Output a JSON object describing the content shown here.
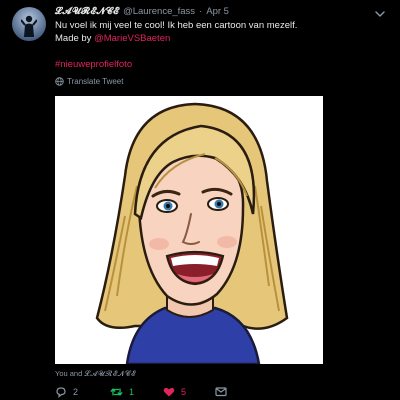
{
  "tweet": {
    "author_name": "𝓛𝓐𝓤𝓡𝓔𝓝𝓒𝓔",
    "handle": "@Laurence_fass",
    "separator": "·",
    "date": "Apr 5",
    "text_line1": "Nu voel ik mij veel te cool! Ik heb een cartoon van mezelf.",
    "text_line2_prefix": "Made by ",
    "text_line2_mention": "@MarieVSBaeten",
    "hashtag": "#nieuweprofielfoto",
    "translate_label": "Translate Tweet"
  },
  "liked_by": {
    "prefix": "You and ",
    "who": "𝓛𝓐𝓤𝓡𝓔𝓝𝓒𝓔"
  },
  "actions": {
    "reply_count": "2",
    "retweet_count": "1",
    "like_count": "5"
  },
  "icons": {
    "reply": "reply-bubble-icon",
    "retweet": "retweet-icon",
    "like": "heart-icon",
    "dm": "envelope-icon",
    "globe": "globe-icon",
    "more": "chevron-down-icon"
  },
  "colors": {
    "background": "#000000",
    "text": "#e7e9ea",
    "secondary": "#8b98a5",
    "mention": "#e0245e",
    "retweet_active": "#17bf63",
    "like_active": "#e0245e"
  }
}
